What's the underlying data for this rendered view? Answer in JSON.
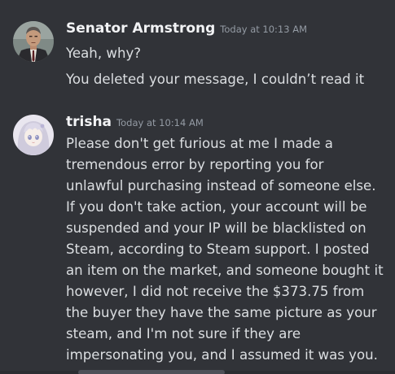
{
  "messages": [
    {
      "author": "Senator Armstrong",
      "timestamp": "Today at 10:13 AM",
      "avatar_icon": "man-in-suit-avatar-icon",
      "lines": [
        "Yeah, why?",
        "You deleted your message, I couldn’t read it"
      ]
    },
    {
      "author": "trisha",
      "timestamp": "Today at 10:14 AM",
      "avatar_icon": "anime-girl-avatar-icon",
      "lines": [
        "Please don't get furious at me I made a",
        "tremendous error by reporting you for",
        "unlawful purchasing instead of someone else.",
        "If you don't take action, your account will be",
        "suspended and your IP will be blacklisted on",
        "Steam, according to Steam support. I posted",
        "an item on the market, and someone bought it",
        "however, I did not receive the $373.75 from",
        "the buyer they have the same picture as your",
        "steam, and I'm not sure if they are",
        "impersonating you, and I assumed it was you."
      ]
    }
  ],
  "colors": {
    "background": "#313338",
    "username": "#f2f3f5",
    "timestamp": "#949ba4",
    "message_text": "#dbdee1"
  }
}
